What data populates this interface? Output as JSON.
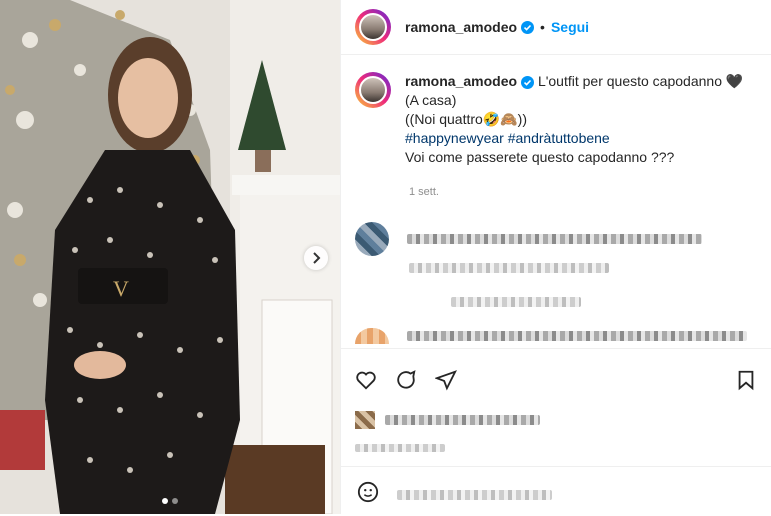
{
  "post": {
    "username": "ramona_amodeo",
    "follow_label": "Segui",
    "separator": "•",
    "caption_username": "ramona_amodeo",
    "caption_line1": "L'outfit per questo capodanno 🖤",
    "caption_line2": "(A casa)",
    "caption_line3": "((Noi quattro🤣🙈))",
    "hashtags": "#happynewyear #andràtuttobene",
    "caption_line5": "Voi come passerete questo capodanno ???",
    "timestamp": "1 sett."
  },
  "carousel": {
    "current_index": 0,
    "total": 2
  },
  "colors": {
    "link_blue": "#0095f6",
    "hashtag": "#00376b",
    "verified": "#0095f6",
    "meta_grey": "#8e8e8e"
  }
}
